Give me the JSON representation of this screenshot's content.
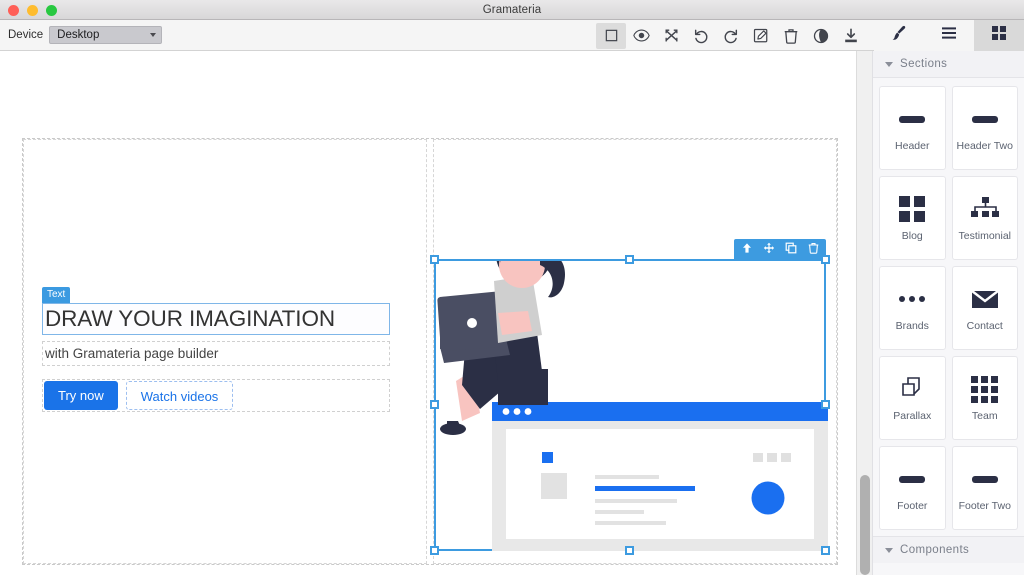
{
  "window": {
    "title": "Gramateria",
    "traffic_lights": [
      "close-red",
      "minimize-yellow",
      "maximize-green"
    ]
  },
  "toolbar": {
    "device_label": "Device",
    "device_value": "Desktop",
    "device_options": [
      "Desktop"
    ],
    "tools": [
      {
        "name": "borders-toggle-icon",
        "title": "Borders",
        "active": true
      },
      {
        "name": "preview-eye-icon",
        "title": "Preview",
        "active": false
      },
      {
        "name": "fullscreen-icon",
        "title": "Fullscreen",
        "active": false
      },
      {
        "name": "undo-icon",
        "title": "Undo",
        "active": false
      },
      {
        "name": "redo-icon",
        "title": "Redo",
        "active": false
      },
      {
        "name": "edit-code-icon",
        "title": "Edit",
        "active": false
      },
      {
        "name": "trash-icon",
        "title": "Delete",
        "active": false
      },
      {
        "name": "globe-icon",
        "title": "Publish",
        "active": false
      },
      {
        "name": "download-icon",
        "title": "Download",
        "active": false
      }
    ],
    "panels": [
      {
        "name": "style-brush-icon",
        "title": "Style Manager",
        "active": false
      },
      {
        "name": "layers-icon",
        "title": "Layers",
        "active": false
      },
      {
        "name": "blocks-grid-icon",
        "title": "Blocks",
        "active": true
      }
    ]
  },
  "canvas": {
    "selected_badge": "Text",
    "hero": {
      "heading": "DRAW YOUR IMAGINATION",
      "subheading": "with Gramateria page builder",
      "primary_button": "Try now",
      "secondary_button": "Watch videos"
    },
    "selection_toolbar": [
      {
        "name": "select-parent-arrow-icon",
        "title": "Select parent"
      },
      {
        "name": "move-icon",
        "title": "Move"
      },
      {
        "name": "copy-icon",
        "title": "Duplicate"
      },
      {
        "name": "trash-icon",
        "title": "Delete"
      }
    ],
    "illustration": {
      "name": "woman-with-laptop-on-browser-illustration",
      "colors": {
        "accent_blue": "#1a73e8",
        "dark_navy": "#2b2f45",
        "skin": "#f8c4c0",
        "shirt_gray": "#cfcfcf",
        "placeholder_gray": "#e4e4e4"
      }
    }
  },
  "sidebar": {
    "sections_panel": {
      "title": "Sections",
      "expanded": true,
      "blocks": [
        {
          "label": "Header",
          "icon": "bar-icon"
        },
        {
          "label": "Header Two",
          "icon": "bar-icon"
        },
        {
          "label": "Blog",
          "icon": "grid-four-icon"
        },
        {
          "label": "Testimonial",
          "icon": "org-chart-icon"
        },
        {
          "label": "Brands",
          "icon": "three-dots-icon"
        },
        {
          "label": "Contact",
          "icon": "envelope-icon"
        },
        {
          "label": "Parallax",
          "icon": "layers-pages-icon"
        },
        {
          "label": "Team",
          "icon": "grid-nine-icon"
        },
        {
          "label": "Footer",
          "icon": "bar-icon"
        },
        {
          "label": "Footer Two",
          "icon": "bar-icon"
        }
      ]
    },
    "components_panel": {
      "title": "Components",
      "expanded": true
    }
  },
  "theme": {
    "accent_blue": "#1a73e8",
    "selection_blue": "#3d9be0",
    "sidebar_bg": "#f7f7f9",
    "icon_navy": "#2b2f45"
  }
}
